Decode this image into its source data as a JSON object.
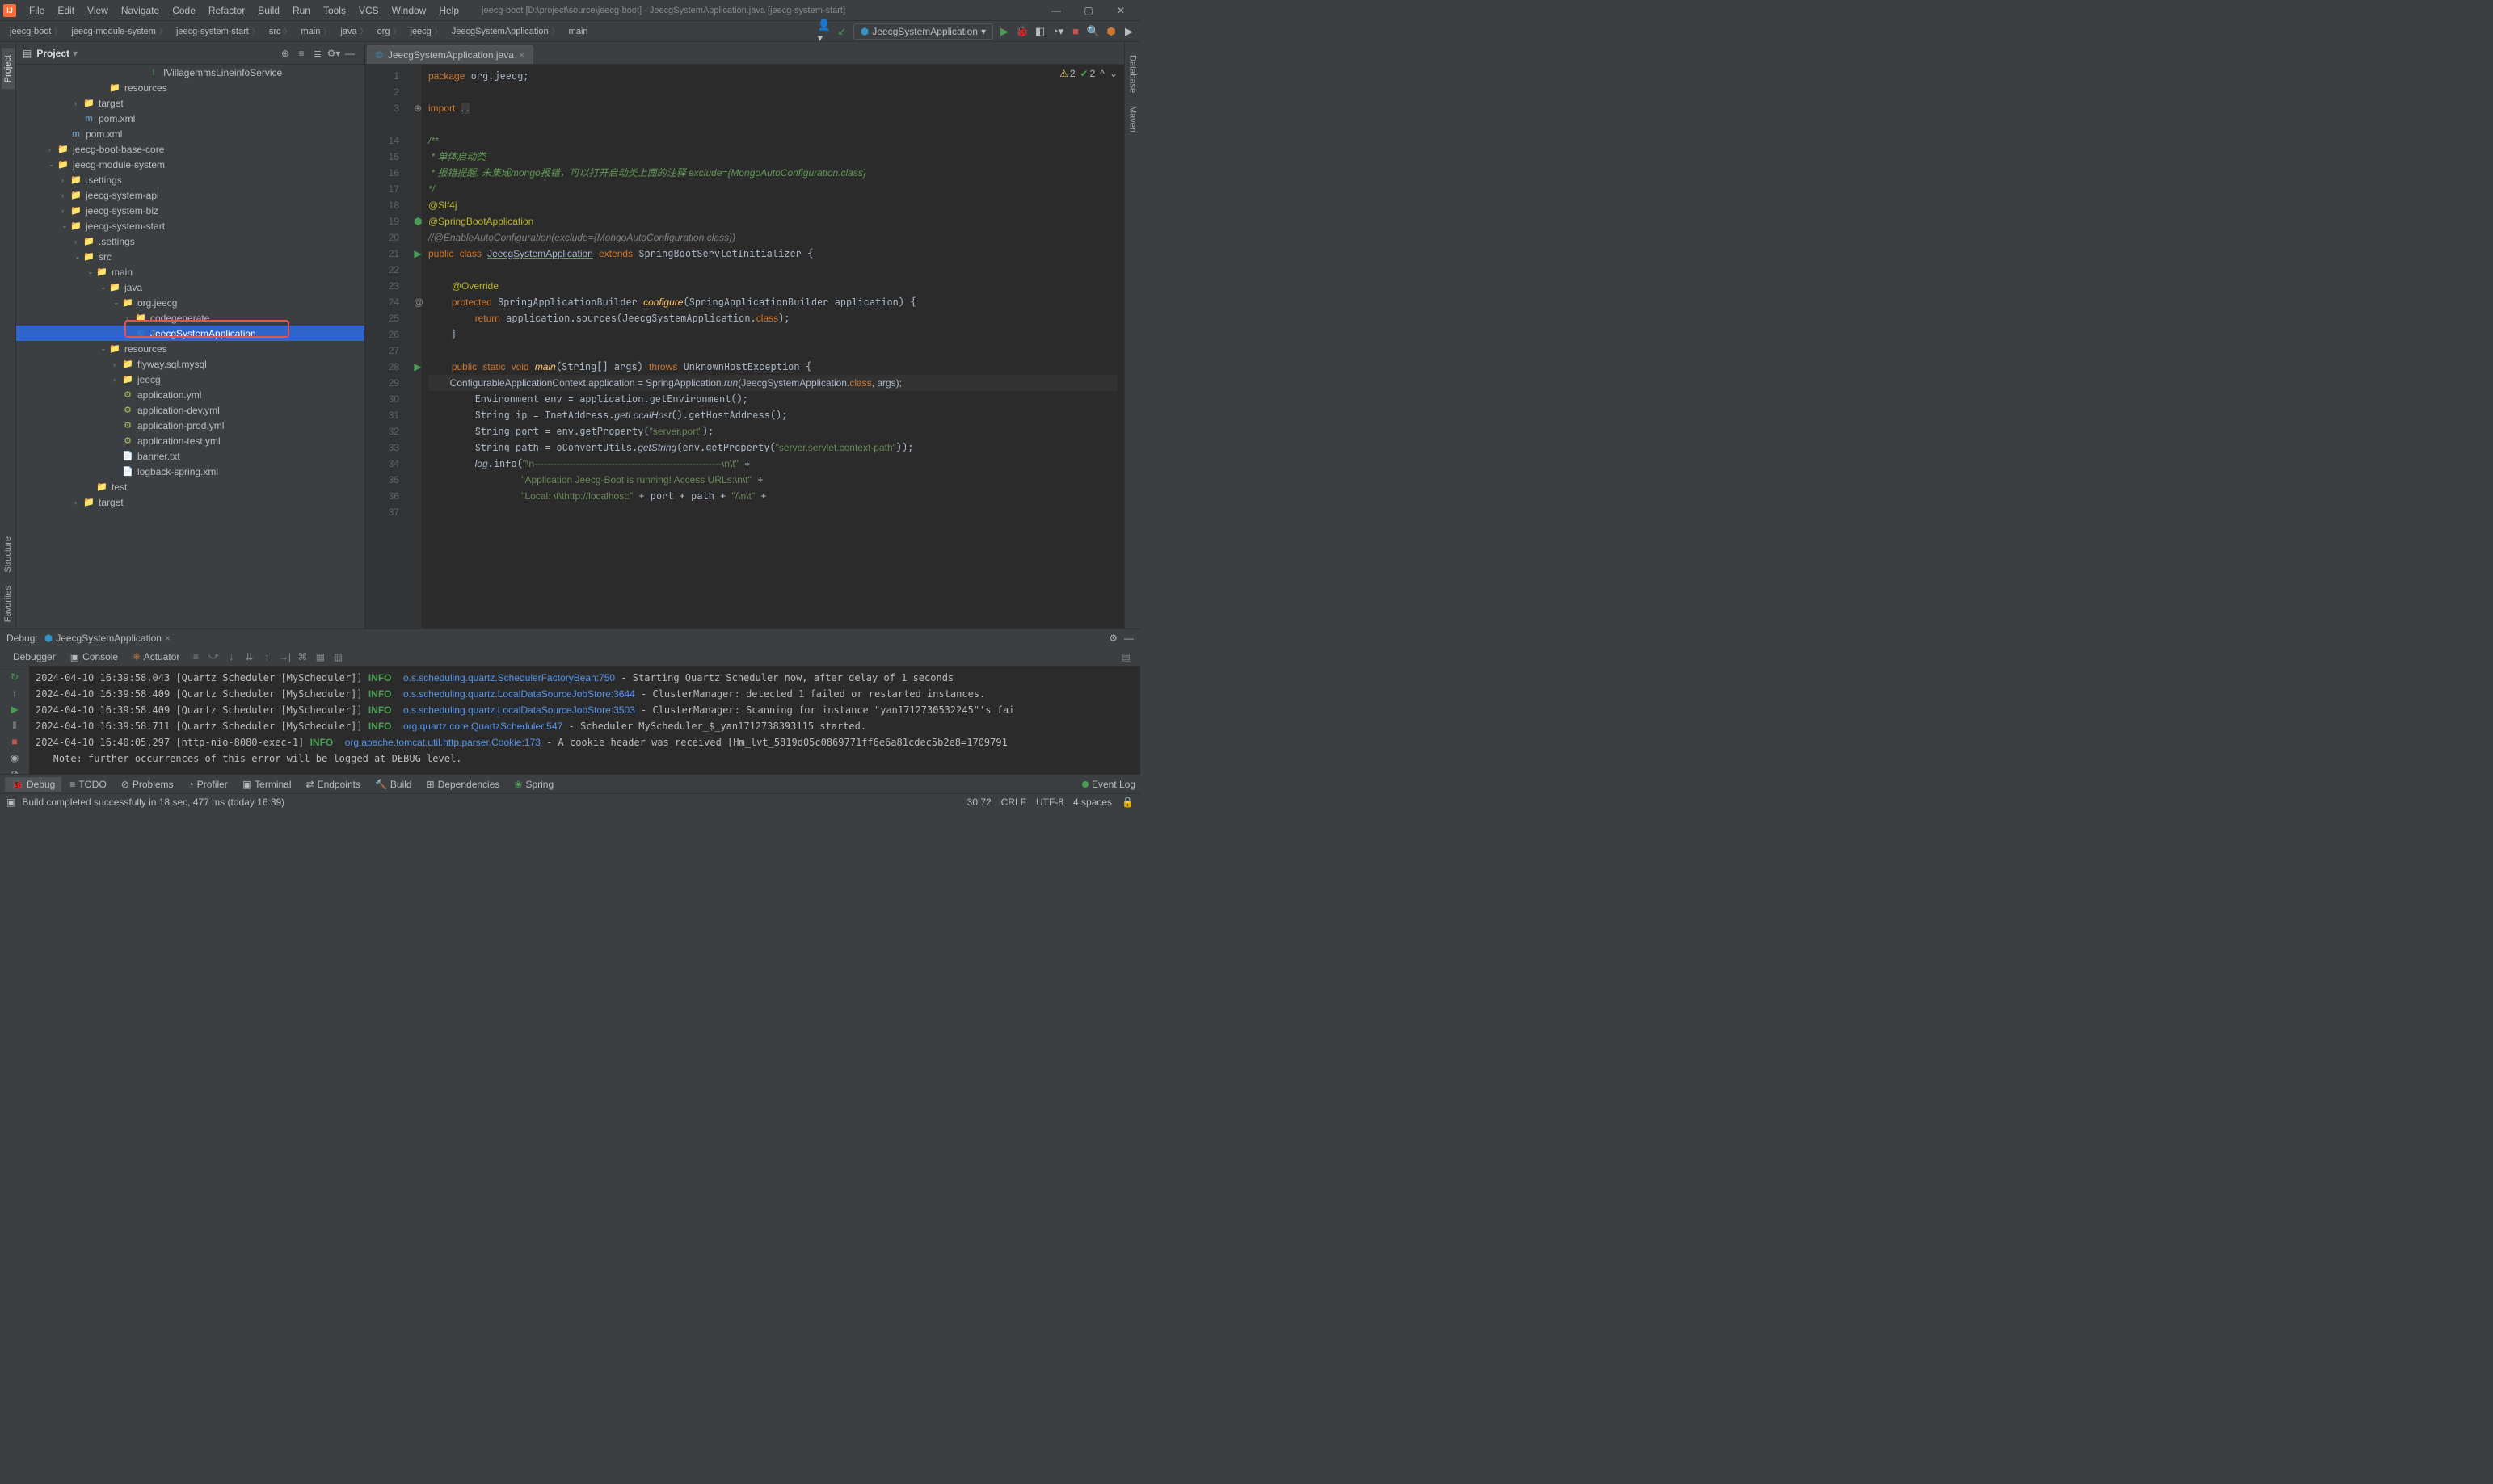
{
  "window": {
    "title": "jeecg-boot [D:\\project\\source\\jeecg-boot] - JeecgSystemApplication.java [jeecg-system-start]"
  },
  "menu": [
    "File",
    "Edit",
    "View",
    "Navigate",
    "Code",
    "Refactor",
    "Build",
    "Run",
    "Tools",
    "VCS",
    "Window",
    "Help"
  ],
  "breadcrumbs": [
    "jeecg-boot",
    "jeecg-module-system",
    "jeecg-system-start",
    "src",
    "main",
    "java",
    "org",
    "jeecg",
    "JeecgSystemApplication",
    "main"
  ],
  "runConfig": "JeecgSystemApplication",
  "projectPanel": {
    "title": "Project"
  },
  "tree": {
    "rows": [
      {
        "indent": 7,
        "arrow": "",
        "icon": "I",
        "iconCls": "green",
        "label": "IVillagemmsLineinfoService"
      },
      {
        "indent": 4,
        "arrow": "",
        "icon": "📁",
        "iconCls": "folder",
        "label": "resources"
      },
      {
        "indent": 2,
        "arrow": "›",
        "icon": "📁",
        "iconCls": "folder-orange",
        "label": "target"
      },
      {
        "indent": 2,
        "arrow": "",
        "icon": "m",
        "iconCls": "file-m",
        "label": "pom.xml"
      },
      {
        "indent": 1,
        "arrow": "",
        "icon": "m",
        "iconCls": "file-m",
        "label": "pom.xml"
      },
      {
        "indent": 0,
        "arrow": "›",
        "icon": "📁",
        "iconCls": "folder-blue",
        "label": "jeecg-boot-base-core"
      },
      {
        "indent": 0,
        "arrow": "⌄",
        "icon": "📁",
        "iconCls": "folder-blue",
        "label": "jeecg-module-system"
      },
      {
        "indent": 1,
        "arrow": "›",
        "icon": "📁",
        "iconCls": "folder",
        "label": ".settings"
      },
      {
        "indent": 1,
        "arrow": "›",
        "icon": "📁",
        "iconCls": "folder-blue",
        "label": "jeecg-system-api"
      },
      {
        "indent": 1,
        "arrow": "›",
        "icon": "📁",
        "iconCls": "folder-blue",
        "label": "jeecg-system-biz"
      },
      {
        "indent": 1,
        "arrow": "⌄",
        "icon": "📁",
        "iconCls": "folder-blue",
        "label": "jeecg-system-start"
      },
      {
        "indent": 2,
        "arrow": "›",
        "icon": "📁",
        "iconCls": "folder",
        "label": ".settings"
      },
      {
        "indent": 2,
        "arrow": "⌄",
        "icon": "📁",
        "iconCls": "folder-blue",
        "label": "src"
      },
      {
        "indent": 3,
        "arrow": "⌄",
        "icon": "📁",
        "iconCls": "folder-blue",
        "label": "main"
      },
      {
        "indent": 4,
        "arrow": "⌄",
        "icon": "📁",
        "iconCls": "folder-blue",
        "label": "java"
      },
      {
        "indent": 5,
        "arrow": "⌄",
        "icon": "📁",
        "iconCls": "folder",
        "label": "org.jeecg"
      },
      {
        "indent": 6,
        "arrow": "›",
        "icon": "📁",
        "iconCls": "folder",
        "label": "codegenerate"
      },
      {
        "indent": 6,
        "arrow": "",
        "icon": "©",
        "iconCls": "blue",
        "label": "JeecgSystemApplication",
        "selected": true
      },
      {
        "indent": 4,
        "arrow": "⌄",
        "icon": "📁",
        "iconCls": "folder",
        "label": "resources"
      },
      {
        "indent": 5,
        "arrow": "›",
        "icon": "📁",
        "iconCls": "folder",
        "label": "flyway.sql.mysql"
      },
      {
        "indent": 5,
        "arrow": "›",
        "icon": "📁",
        "iconCls": "folder",
        "label": "jeecg"
      },
      {
        "indent": 5,
        "arrow": "",
        "icon": "⚙",
        "iconCls": "file-y",
        "label": "application.yml"
      },
      {
        "indent": 5,
        "arrow": "",
        "icon": "⚙",
        "iconCls": "file-y",
        "label": "application-dev.yml"
      },
      {
        "indent": 5,
        "arrow": "",
        "icon": "⚙",
        "iconCls": "file-y",
        "label": "application-prod.yml"
      },
      {
        "indent": 5,
        "arrow": "",
        "icon": "⚙",
        "iconCls": "file-y",
        "label": "application-test.yml"
      },
      {
        "indent": 5,
        "arrow": "",
        "icon": "📄",
        "iconCls": "folder",
        "label": "banner.txt"
      },
      {
        "indent": 5,
        "arrow": "",
        "icon": "📄",
        "iconCls": "folder",
        "label": "logback-spring.xml"
      },
      {
        "indent": 3,
        "arrow": "",
        "icon": "📁",
        "iconCls": "folder",
        "label": "test"
      },
      {
        "indent": 2,
        "arrow": "›",
        "icon": "📁",
        "iconCls": "folder-orange",
        "label": "target"
      }
    ]
  },
  "editor": {
    "tabLabel": "JeecgSystemApplication.java",
    "lineNumbers": [
      "1",
      "2",
      "3",
      "",
      "14",
      "15",
      "16",
      "17",
      "18",
      "19",
      "20",
      "21",
      "22",
      "23",
      "24",
      "25",
      "26",
      "27",
      "28",
      "29",
      "30",
      "31",
      "32",
      "33",
      "34",
      "35",
      "36",
      "37"
    ],
    "analysis": {
      "warn": "2",
      "ok": "2"
    }
  },
  "debug": {
    "label": "Debug:",
    "tab": "JeecgSystemApplication",
    "subtabs": [
      "Debugger",
      "Console",
      "Actuator"
    ],
    "lines": [
      {
        "ts": "2024-04-10 16:39:58.043",
        "src": "[Quartz Scheduler [MyScheduler]]",
        "lvl": "INFO",
        "cls": "o.s.scheduling.quartz.SchedulerFactoryBean:",
        "ln": "750",
        "msg": " - Starting Quartz Scheduler now, after delay of 1 seconds"
      },
      {
        "ts": "2024-04-10 16:39:58.409",
        "src": "[Quartz Scheduler [MyScheduler]]",
        "lvl": "INFO",
        "cls": "o.s.scheduling.quartz.LocalDataSourceJobStore:",
        "ln": "3644",
        "msg": " - ClusterManager: detected 1 failed or restarted instances."
      },
      {
        "ts": "2024-04-10 16:39:58.409",
        "src": "[Quartz Scheduler [MyScheduler]]",
        "lvl": "INFO",
        "cls": "o.s.scheduling.quartz.LocalDataSourceJobStore:",
        "ln": "3503",
        "msg": " - ClusterManager: Scanning for instance \"yan1712730532245\"'s fai"
      },
      {
        "ts": "2024-04-10 16:39:58.711",
        "src": "[Quartz Scheduler [MyScheduler]]",
        "lvl": "INFO",
        "cls": "org.quartz.core.QuartzScheduler:",
        "ln": "547",
        "msg": " - Scheduler MyScheduler_$_yan1712738393115 started."
      },
      {
        "ts": "2024-04-10 16:40:05.297",
        "src": "[http-nio-8080-exec-1]",
        "lvl": "INFO",
        "cls": "org.apache.tomcat.util.http.parser.Cookie:",
        "ln": "173",
        "msg": " - A cookie header was received [Hm_lvt_5819d05c0869771ff6e6a81cdec5b2e8=1709791"
      }
    ],
    "note": "   Note: further occurrences of this error will be logged at DEBUG level.",
    "dots": "..."
  },
  "bottomTabs": [
    "Debug",
    "TODO",
    "Problems",
    "Profiler",
    "Terminal",
    "Endpoints",
    "Build",
    "Dependencies",
    "Spring"
  ],
  "eventLog": "Event Log",
  "status": {
    "msg": "Build completed successfully in 18 sec, 477 ms (today 16:39)",
    "pos": "30:72",
    "eol": "CRLF",
    "enc": "UTF-8",
    "indent": "4 spaces"
  },
  "leftTabs": [
    "Project",
    "Structure",
    "Favorites"
  ],
  "rightTabs": [
    "Database",
    "Maven"
  ]
}
